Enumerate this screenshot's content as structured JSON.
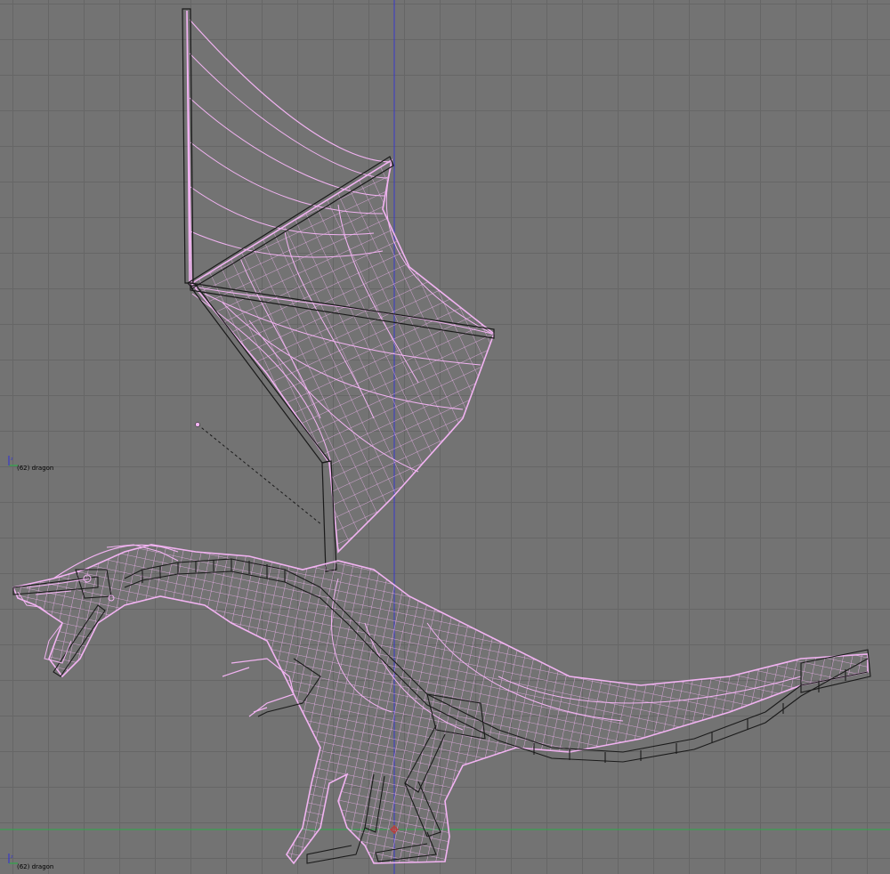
{
  "viewport": {
    "background_color": "#737373",
    "grid_color": "#666666",
    "wire_color": "#f2b3f2",
    "bone_color": "#1a1a1a",
    "axis_x_color": "#2ea84a",
    "axis_y_color": "#3838c8"
  },
  "overlays": {
    "upper_label": "(62) dragon",
    "lower_label": "(62) dragon"
  },
  "icons": {
    "axis_widget": "xyz-axis-icon",
    "origin": "3d-cursor-icon"
  }
}
